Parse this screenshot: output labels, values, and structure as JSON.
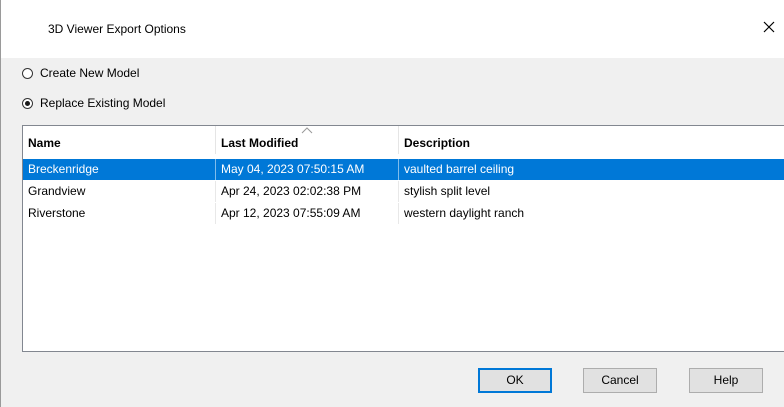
{
  "window": {
    "title": "3D Viewer Export Options",
    "close_icon": "close-icon"
  },
  "options": {
    "create_new": {
      "label": "Create New Model",
      "checked": false
    },
    "replace_existing": {
      "label": "Replace Existing Model",
      "checked": true
    }
  },
  "table": {
    "columns": [
      "Name",
      "Last Modified",
      "Description"
    ],
    "sorted_column": "Last Modified",
    "rows": [
      {
        "name": "Breckenridge",
        "modified": "May 04, 2023 07:50:15 AM",
        "description": "vaulted barrel ceiling",
        "selected": true
      },
      {
        "name": "Grandview",
        "modified": "Apr 24, 2023 02:02:38 PM",
        "description": "stylish split level",
        "selected": false
      },
      {
        "name": "Riverstone",
        "modified": "Apr 12, 2023 07:55:09 AM",
        "description": "western daylight ranch",
        "selected": false
      }
    ]
  },
  "buttons": {
    "ok": "OK",
    "cancel": "Cancel",
    "help": "Help"
  },
  "colors": {
    "selection": "#0078d7",
    "dialog_bg": "#f0f0f0"
  }
}
